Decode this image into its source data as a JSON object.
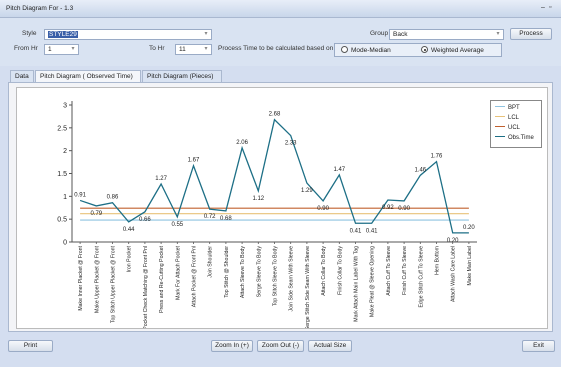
{
  "window": {
    "title": "Pitch Diagram For - 1.3"
  },
  "form": {
    "style_label": "Style",
    "style_value": "STYLE29",
    "group_label": "Group",
    "group_value": "Back",
    "process_button": "Process",
    "from_hr_label": "From Hr",
    "from_hr_value": "1",
    "to_hr_label": "To Hr",
    "to_hr_value": "11",
    "basis_label": "Process Time to be calculated based on",
    "radio_mode": "Mode-Median",
    "radio_weighted": "Weighted Average",
    "selected_radio": "weighted"
  },
  "tabs": [
    {
      "label": "Data"
    },
    {
      "label": "Pitch Diagram ( Observed Time)"
    },
    {
      "label": "Pitch Diagram (Pieces)"
    }
  ],
  "footer": {
    "print": "Print",
    "zoom_in": "Zoom In (+)",
    "zoom_out": "Zoom Out (-)",
    "actual_size": "Actual Size",
    "exit": "Exit"
  },
  "chart_data": {
    "type": "line",
    "ylim": [
      0,
      3
    ],
    "yticks": [
      "0",
      "0.5",
      "1",
      "1.5",
      "2",
      "2.5",
      "3"
    ],
    "categories": [
      "Make Inner Placket @ Front",
      "Make Upper Placket @ Front",
      "Top Stitch Upper Placket @ Front",
      "Iron Pocket",
      "Pocket Check Matching @ Front Pnl",
      "Press and Re-Cutting Pocket",
      "Mark For Attach Pocket",
      "Attach Pocket @ Front Pnl",
      "Join Shoulder",
      "Top Stitch @ Shoulder",
      "Attach Sleeve To Body",
      "Serge Sleeve To Body",
      "Top Stitch Sleeve To Body",
      "Join Side Seam With Sleeve",
      "Serge Stitch Side Seam With Sleeve",
      "Attach Collar To Body",
      "Finish Collar To Body",
      "Mark Attach Main Label With Tag",
      "Make Pleat @ Sleeve Opening",
      "Attach Cuff To Sleeve",
      "Finish Cuff To Sleeve",
      "Edge Stitch Cuff To Sleeve",
      "Hem Bottom",
      "Attach Wash Care Label",
      "Make Main Label"
    ],
    "series": [
      {
        "name": "BPT",
        "color": "#8fc3e0",
        "values": [
          0.48,
          0.48,
          0.48,
          0.48,
          0.48,
          0.48,
          0.48,
          0.48,
          0.48,
          0.48,
          0.48,
          0.48,
          0.48,
          0.48,
          0.48,
          0.48,
          0.48,
          0.48,
          0.48,
          0.48,
          0.48,
          0.48,
          0.48,
          0.48,
          0.48
        ]
      },
      {
        "name": "LCL",
        "color": "#e8c27a",
        "values": [
          0.62,
          0.62,
          0.62,
          0.62,
          0.62,
          0.62,
          0.62,
          0.62,
          0.62,
          0.62,
          0.62,
          0.62,
          0.62,
          0.62,
          0.62,
          0.62,
          0.62,
          0.62,
          0.62,
          0.62,
          0.62,
          0.62,
          0.62,
          0.62,
          0.62
        ]
      },
      {
        "name": "UCL",
        "color": "#c0612f",
        "values": [
          0.74,
          0.74,
          0.74,
          0.74,
          0.74,
          0.74,
          0.74,
          0.74,
          0.74,
          0.74,
          0.74,
          0.74,
          0.74,
          0.74,
          0.74,
          0.74,
          0.74,
          0.74,
          0.74,
          0.74,
          0.74,
          0.74,
          0.74,
          0.74,
          0.74
        ]
      },
      {
        "name": "Obs.Time",
        "color": "#1d6f86",
        "values": [
          0.91,
          0.79,
          0.86,
          0.44,
          0.66,
          1.27,
          0.55,
          1.67,
          0.72,
          0.68,
          2.06,
          1.12,
          2.68,
          2.33,
          1.29,
          0.9,
          1.47,
          0.41,
          0.41,
          0.92,
          0.9,
          1.46,
          1.76,
          0.2,
          0.2
        ],
        "labels": [
          "0.91",
          "0.79",
          "0.86",
          "0.44",
          "0.66",
          "1.27",
          "0.55",
          "1.67",
          "0.72",
          "0.68",
          "2.06",
          "1.12",
          "2.68",
          "2.33",
          "1.29",
          "0.90",
          "1.47",
          "0.41",
          "0.41",
          "0.92",
          "0.90",
          "1.46",
          "1.76",
          "0.20",
          "0.20"
        ]
      }
    ]
  }
}
